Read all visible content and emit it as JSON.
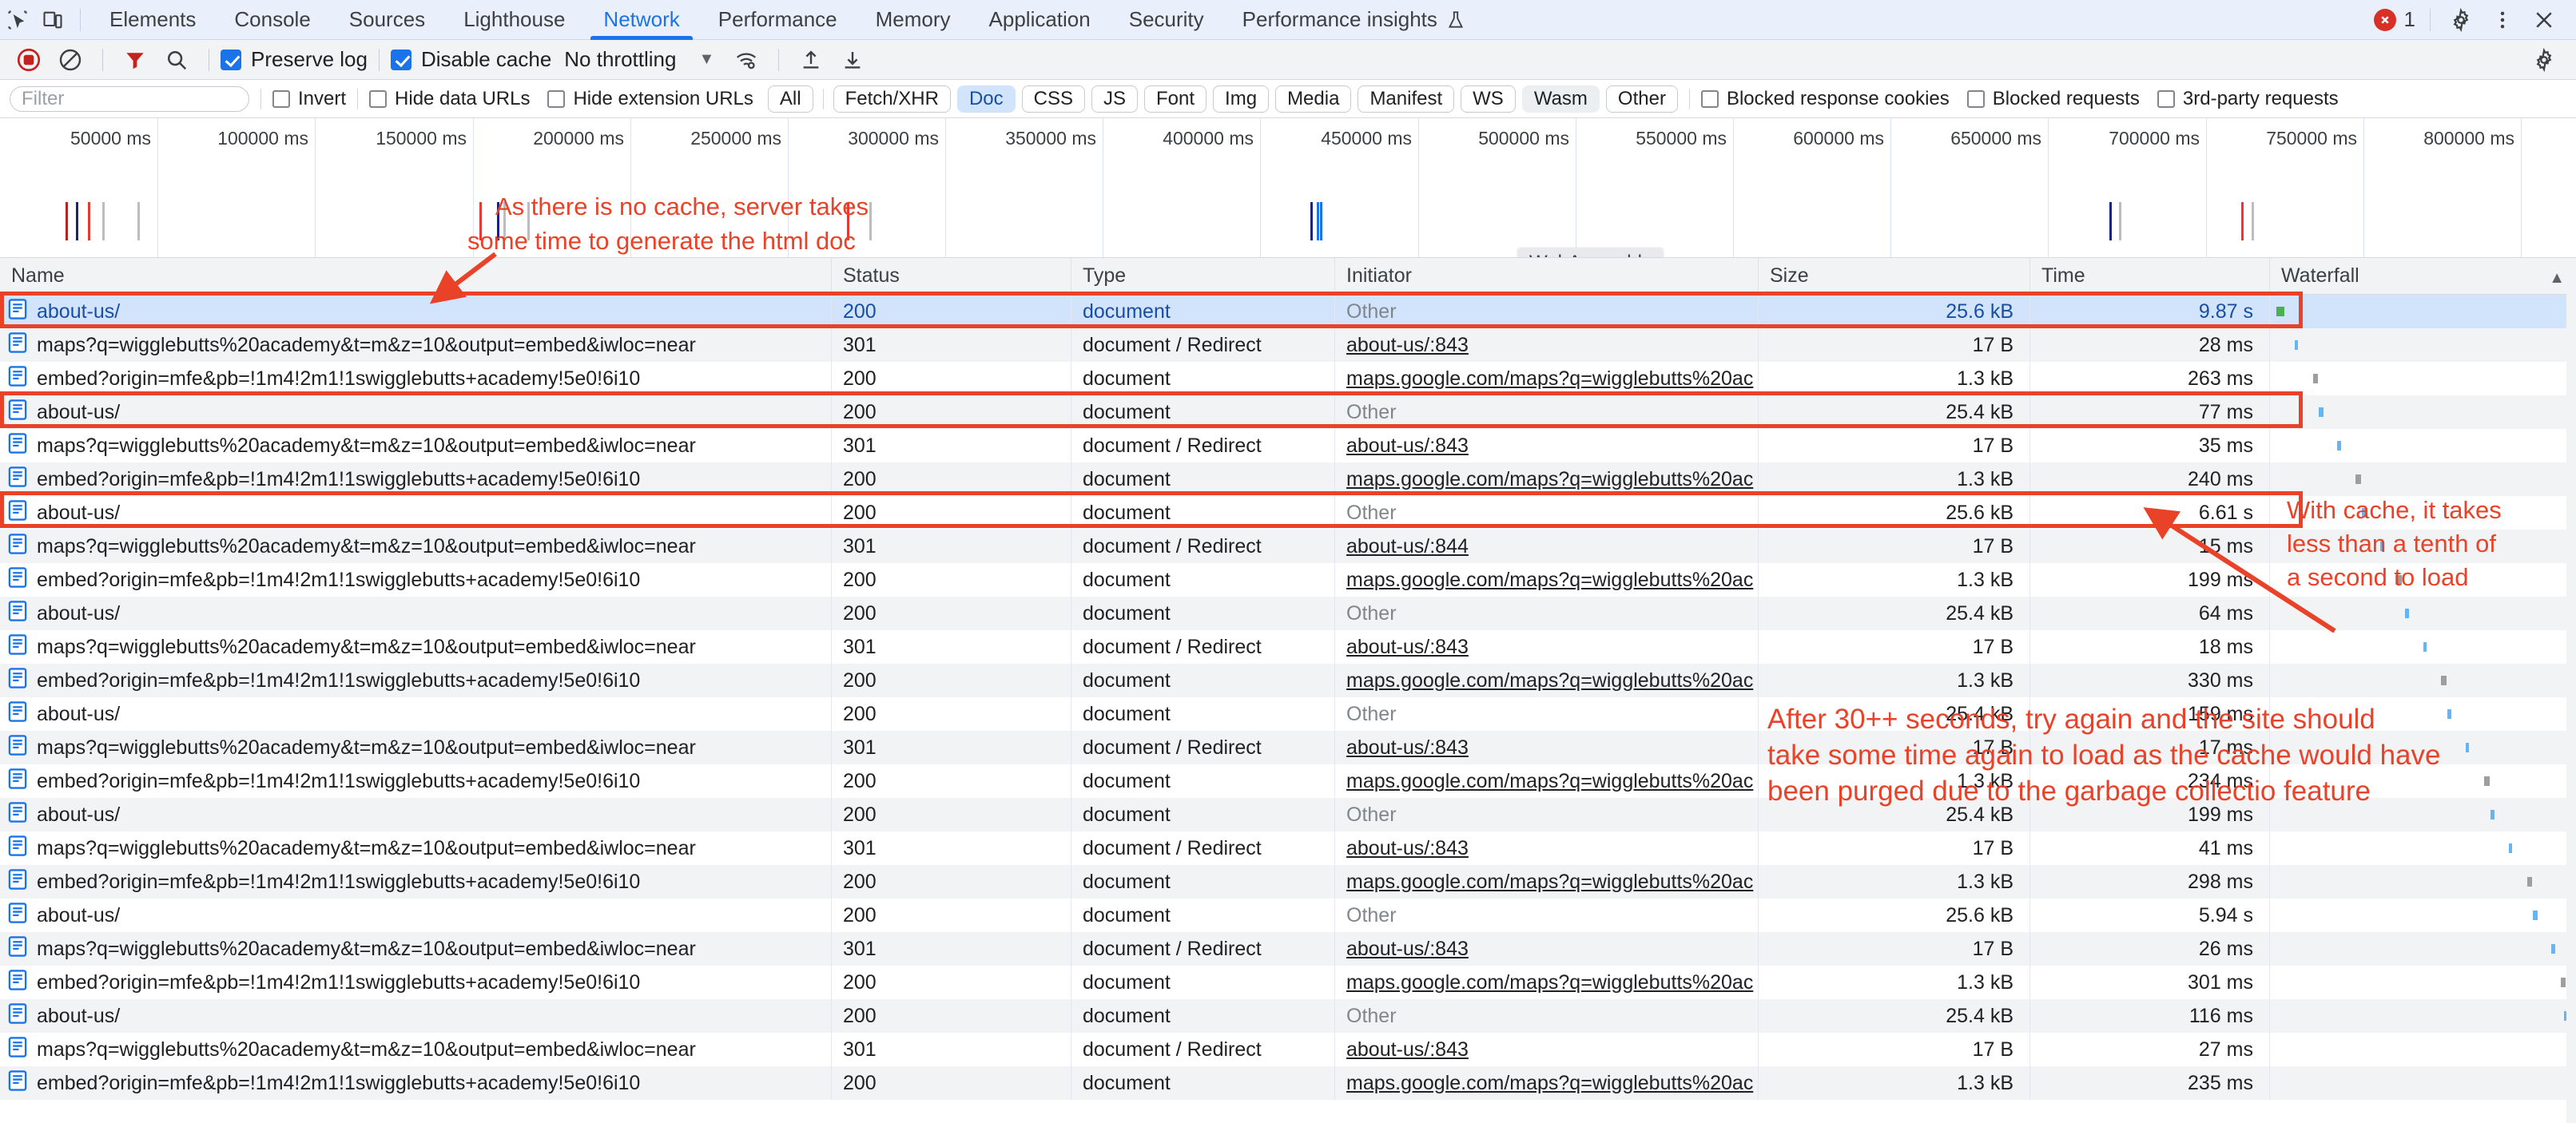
{
  "tabbar": {
    "left_icons": [
      {
        "name": "inspect-element-icon"
      },
      {
        "name": "device-toolbar-icon"
      }
    ],
    "tabs": [
      {
        "label": "Elements",
        "active": false
      },
      {
        "label": "Console",
        "active": false
      },
      {
        "label": "Sources",
        "active": false
      },
      {
        "label": "Lighthouse",
        "active": false
      },
      {
        "label": "Network",
        "active": true
      },
      {
        "label": "Performance",
        "active": false
      },
      {
        "label": "Memory",
        "active": false
      },
      {
        "label": "Application",
        "active": false
      },
      {
        "label": "Security",
        "active": false
      },
      {
        "label": "Performance insights",
        "active": false,
        "beaker": true
      }
    ],
    "error_count": "1",
    "right_icons": [
      "gear-icon",
      "more-vertical-icon",
      "close-icon"
    ]
  },
  "toolbar": {
    "record_title": "record-stop-button",
    "clear_title": "clear-button",
    "filter_title": "filter-toggle",
    "search_title": "search-button",
    "preserve_log_label": "Preserve log",
    "preserve_log_checked": true,
    "disable_cache_label": "Disable cache",
    "disable_cache_checked": true,
    "throttling_value": "No throttling",
    "wifi_title": "network-conditions-icon",
    "import_title": "import-har-icon",
    "export_title": "export-har-icon",
    "settings_title": "network-settings-gear"
  },
  "filterbar": {
    "filter_placeholder": "Filter",
    "filter_value": "",
    "invert_label": "Invert",
    "hide_data_urls_label": "Hide data URLs",
    "hide_extension_urls_label": "Hide extension URLs",
    "types": [
      {
        "label": "All",
        "state": "normal"
      },
      {
        "label": "Fetch/XHR",
        "state": "normal"
      },
      {
        "label": "Doc",
        "state": "selected"
      },
      {
        "label": "CSS",
        "state": "normal"
      },
      {
        "label": "JS",
        "state": "normal"
      },
      {
        "label": "Font",
        "state": "normal"
      },
      {
        "label": "Img",
        "state": "normal"
      },
      {
        "label": "Media",
        "state": "normal"
      },
      {
        "label": "Manifest",
        "state": "normal"
      },
      {
        "label": "WS",
        "state": "normal"
      },
      {
        "label": "Wasm",
        "state": "hover"
      },
      {
        "label": "Other",
        "state": "normal"
      }
    ],
    "blocked_response_cookies_label": "Blocked response cookies",
    "blocked_requests_label": "Blocked requests",
    "third_party_requests_label": "3rd-party requests"
  },
  "overview": {
    "tick_labels": [
      "50000 ms",
      "100000 ms",
      "150000 ms",
      "200000 ms",
      "250000 ms",
      "300000 ms",
      "350000 ms",
      "400000 ms",
      "450000 ms",
      "500000 ms",
      "550000 ms",
      "600000 ms",
      "650000 ms",
      "700000 ms",
      "750000 ms",
      "800000 ms"
    ],
    "tooltip": "WebAssembly"
  },
  "table": {
    "columns": [
      "Name",
      "Status",
      "Type",
      "Initiator",
      "Size",
      "Time",
      "Waterfall"
    ],
    "rows": [
      {
        "name": "about-us/",
        "status": "200",
        "type": "document",
        "initiator": "Other",
        "initiator_link": false,
        "size": "25.6 kB",
        "time": "9.87 s",
        "selected": true
      },
      {
        "name": "maps?q=wigglebutts%20academy&t=m&z=10&output=embed&iwloc=near",
        "status": "301",
        "type": "document / Redirect",
        "initiator": "about-us/:843",
        "initiator_link": true,
        "size": "17 B",
        "time": "28 ms",
        "selected": false
      },
      {
        "name": "embed?origin=mfe&pb=!1m4!2m1!1swigglebutts+academy!5e0!6i10",
        "status": "200",
        "type": "document",
        "initiator": "maps.google.com/maps?q=wigglebutts%20ac",
        "initiator_link": true,
        "size": "1.3 kB",
        "time": "263 ms",
        "selected": false
      },
      {
        "name": "about-us/",
        "status": "200",
        "type": "document",
        "initiator": "Other",
        "initiator_link": false,
        "size": "25.4 kB",
        "time": "77 ms",
        "selected": false
      },
      {
        "name": "maps?q=wigglebutts%20academy&t=m&z=10&output=embed&iwloc=near",
        "status": "301",
        "type": "document / Redirect",
        "initiator": "about-us/:843",
        "initiator_link": true,
        "size": "17 B",
        "time": "35 ms",
        "selected": false
      },
      {
        "name": "embed?origin=mfe&pb=!1m4!2m1!1swigglebutts+academy!5e0!6i10",
        "status": "200",
        "type": "document",
        "initiator": "maps.google.com/maps?q=wigglebutts%20ac",
        "initiator_link": true,
        "size": "1.3 kB",
        "time": "240 ms",
        "selected": false
      },
      {
        "name": "about-us/",
        "status": "200",
        "type": "document",
        "initiator": "Other",
        "initiator_link": false,
        "size": "25.6 kB",
        "time": "6.61 s",
        "selected": false
      },
      {
        "name": "maps?q=wigglebutts%20academy&t=m&z=10&output=embed&iwloc=near",
        "status": "301",
        "type": "document / Redirect",
        "initiator": "about-us/:844",
        "initiator_link": true,
        "size": "17 B",
        "time": "15 ms",
        "selected": false
      },
      {
        "name": "embed?origin=mfe&pb=!1m4!2m1!1swigglebutts+academy!5e0!6i10",
        "status": "200",
        "type": "document",
        "initiator": "maps.google.com/maps?q=wigglebutts%20ac",
        "initiator_link": true,
        "size": "1.3 kB",
        "time": "199 ms",
        "selected": false
      },
      {
        "name": "about-us/",
        "status": "200",
        "type": "document",
        "initiator": "Other",
        "initiator_link": false,
        "size": "25.4 kB",
        "time": "64 ms",
        "selected": false
      },
      {
        "name": "maps?q=wigglebutts%20academy&t=m&z=10&output=embed&iwloc=near",
        "status": "301",
        "type": "document / Redirect",
        "initiator": "about-us/:843",
        "initiator_link": true,
        "size": "17 B",
        "time": "18 ms",
        "selected": false
      },
      {
        "name": "embed?origin=mfe&pb=!1m4!2m1!1swigglebutts+academy!5e0!6i10",
        "status": "200",
        "type": "document",
        "initiator": "maps.google.com/maps?q=wigglebutts%20ac",
        "initiator_link": true,
        "size": "1.3 kB",
        "time": "330 ms",
        "selected": false
      },
      {
        "name": "about-us/",
        "status": "200",
        "type": "document",
        "initiator": "Other",
        "initiator_link": false,
        "size": "25.4 kB",
        "time": "159 ms",
        "selected": false
      },
      {
        "name": "maps?q=wigglebutts%20academy&t=m&z=10&output=embed&iwloc=near",
        "status": "301",
        "type": "document / Redirect",
        "initiator": "about-us/:843",
        "initiator_link": true,
        "size": "17 B",
        "time": "17 ms",
        "selected": false
      },
      {
        "name": "embed?origin=mfe&pb=!1m4!2m1!1swigglebutts+academy!5e0!6i10",
        "status": "200",
        "type": "document",
        "initiator": "maps.google.com/maps?q=wigglebutts%20ac",
        "initiator_link": true,
        "size": "1.3 kB",
        "time": "234 ms",
        "selected": false
      },
      {
        "name": "about-us/",
        "status": "200",
        "type": "document",
        "initiator": "Other",
        "initiator_link": false,
        "size": "25.4 kB",
        "time": "199 ms",
        "selected": false
      },
      {
        "name": "maps?q=wigglebutts%20academy&t=m&z=10&output=embed&iwloc=near",
        "status": "301",
        "type": "document / Redirect",
        "initiator": "about-us/:843",
        "initiator_link": true,
        "size": "17 B",
        "time": "41 ms",
        "selected": false
      },
      {
        "name": "embed?origin=mfe&pb=!1m4!2m1!1swigglebutts+academy!5e0!6i10",
        "status": "200",
        "type": "document",
        "initiator": "maps.google.com/maps?q=wigglebutts%20ac",
        "initiator_link": true,
        "size": "1.3 kB",
        "time": "298 ms",
        "selected": false
      },
      {
        "name": "about-us/",
        "status": "200",
        "type": "document",
        "initiator": "Other",
        "initiator_link": false,
        "size": "25.6 kB",
        "time": "5.94 s",
        "selected": false
      },
      {
        "name": "maps?q=wigglebutts%20academy&t=m&z=10&output=embed&iwloc=near",
        "status": "301",
        "type": "document / Redirect",
        "initiator": "about-us/:843",
        "initiator_link": true,
        "size": "17 B",
        "time": "26 ms",
        "selected": false
      },
      {
        "name": "embed?origin=mfe&pb=!1m4!2m1!1swigglebutts+academy!5e0!6i10",
        "status": "200",
        "type": "document",
        "initiator": "maps.google.com/maps?q=wigglebutts%20ac",
        "initiator_link": true,
        "size": "1.3 kB",
        "time": "301 ms",
        "selected": false
      },
      {
        "name": "about-us/",
        "status": "200",
        "type": "document",
        "initiator": "Other",
        "initiator_link": false,
        "size": "25.4 kB",
        "time": "116 ms",
        "selected": false
      },
      {
        "name": "maps?q=wigglebutts%20academy&t=m&z=10&output=embed&iwloc=near",
        "status": "301",
        "type": "document / Redirect",
        "initiator": "about-us/:843",
        "initiator_link": true,
        "size": "17 B",
        "time": "27 ms",
        "selected": false
      },
      {
        "name": "embed?origin=mfe&pb=!1m4!2m1!1swigglebutts+academy!5e0!6i10",
        "status": "200",
        "type": "document",
        "initiator": "maps.google.com/maps?q=wigglebutts%20ac",
        "initiator_link": true,
        "size": "1.3 kB",
        "time": "235 ms",
        "selected": false
      }
    ]
  },
  "annotations": [
    {
      "id": "no-cache-note",
      "lines": [
        "As there is no cache, server takes",
        "some time to generate the html doc"
      ]
    },
    {
      "id": "with-cache-note",
      "lines": [
        "With cache, it takes",
        "less than a tenth of",
        "a second to load"
      ]
    },
    {
      "id": "garbage-collection-note",
      "lines": [
        "After 30++ seconds, try again and the site should",
        "take some time again to load as the cache would have",
        "been purged due to the garbage collectio feature"
      ]
    }
  ],
  "colors": {
    "accent_blue": "#1a73e8",
    "annotation_red": "#ea4228",
    "error_red": "#d93025",
    "selected_row": "#d2e3fc"
  }
}
